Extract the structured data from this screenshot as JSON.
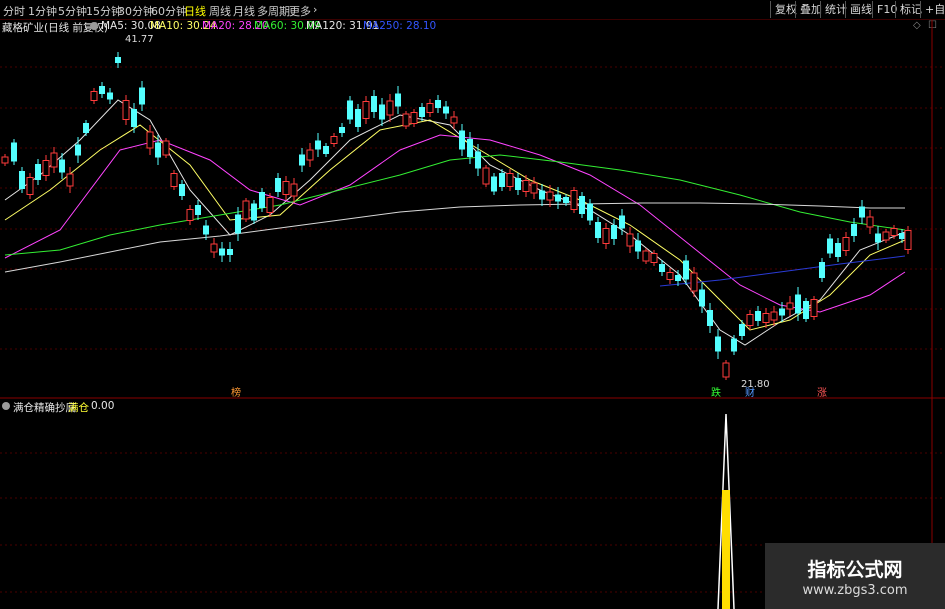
{
  "toolbar": {
    "periods": [
      "分时",
      "1分钟",
      "5分钟",
      "15分钟",
      "30分钟",
      "60分钟",
      "日线",
      "周线",
      "月线",
      "多周期",
      "更多"
    ],
    "active_period": "日线",
    "more_arrow": "›",
    "right_buttons": [
      "复权",
      "叠加",
      "统计",
      "画线",
      "F10",
      "标记",
      "+自选"
    ]
  },
  "main": {
    "stock_title": "藏格矿业(日线 前复权)",
    "ma_items": [
      {
        "label": "MA5: 30.08",
        "color": "#e6e6e6"
      },
      {
        "label": "MA10: 30.24",
        "color": "#ffff66"
      },
      {
        "label": "MA20: 28.20",
        "color": "#ff44ff"
      },
      {
        "label": "MA60: 30.09",
        "color": "#33ee33"
      },
      {
        "label": "MA120: 31.91",
        "color": "#e6e6e6"
      },
      {
        "label": "MA250: 28.10",
        "color": "#3355ff"
      }
    ],
    "high_label": "41.77",
    "low_label": "21.80",
    "markers": [
      {
        "text": "榜",
        "color": "#ff9933"
      },
      {
        "text": "跌",
        "color": "#33ff33"
      },
      {
        "text": "财",
        "color": "#5599ff"
      },
      {
        "text": "涨",
        "color": "#ff5555"
      }
    ]
  },
  "sub": {
    "indicator_name": "满仓精确抄底",
    "value_label": "满仓",
    "value": "0.00"
  },
  "watermark": {
    "title": "指标公式网",
    "url": "www.zbgs3.com"
  }
}
